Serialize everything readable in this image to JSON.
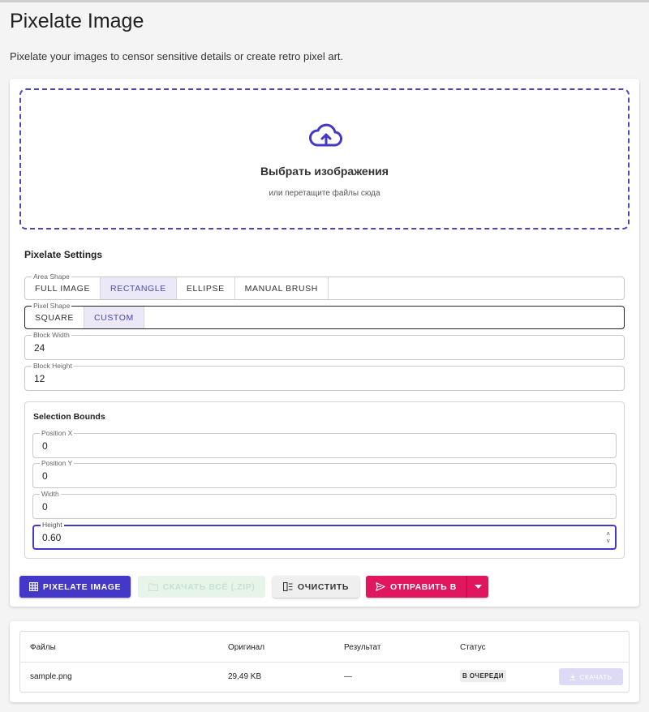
{
  "page": {
    "title": "Pixelate Image",
    "description": "Pixelate your images to censor sensitive details or create retro pixel art."
  },
  "dropzone": {
    "title": "Выбрать изображения",
    "subtitle": "или перетащите файлы сюда",
    "icon": "cloud-upload-icon"
  },
  "settings": {
    "title": "Pixelate Settings",
    "area_shape": {
      "label": "Area Shape",
      "options": [
        "FULL IMAGE",
        "RECTANGLE",
        "ELLIPSE",
        "MANUAL BRUSH"
      ],
      "selected": "RECTANGLE"
    },
    "pixel_shape": {
      "label": "Pixel Shape",
      "options": [
        "SQUARE",
        "CUSTOM"
      ],
      "selected": "CUSTOM"
    },
    "block_width": {
      "label": "Block Width",
      "value": "24"
    },
    "block_height": {
      "label": "Block Height",
      "value": "12"
    },
    "bounds": {
      "title": "Selection Bounds",
      "position_x": {
        "label": "Position X",
        "value": "0"
      },
      "position_y": {
        "label": "Position Y",
        "value": "0"
      },
      "width": {
        "label": "Width",
        "value": "0"
      },
      "height": {
        "label": "Height",
        "value": "0.60"
      }
    }
  },
  "actions": {
    "pixelate": "PIXELATE IMAGE",
    "download_zip": "СКАЧАТЬ ВСЁ (.ZIP)",
    "clear": "ОЧИСТИТЬ",
    "send_to": "ОТПРАВИТЬ В"
  },
  "files_table": {
    "headers": [
      "Файлы",
      "Оригинал",
      "Результат",
      "Статус"
    ],
    "rows": [
      {
        "file": "sample.png",
        "original": "29,49 KB",
        "result": "—",
        "status": "В ОЧЕРЕДИ",
        "download": "СКАЧАТЬ"
      }
    ]
  },
  "colors": {
    "accent": "#4338c8",
    "send": "#e0175f",
    "selected_segment_bg": "#ebe9f8"
  }
}
